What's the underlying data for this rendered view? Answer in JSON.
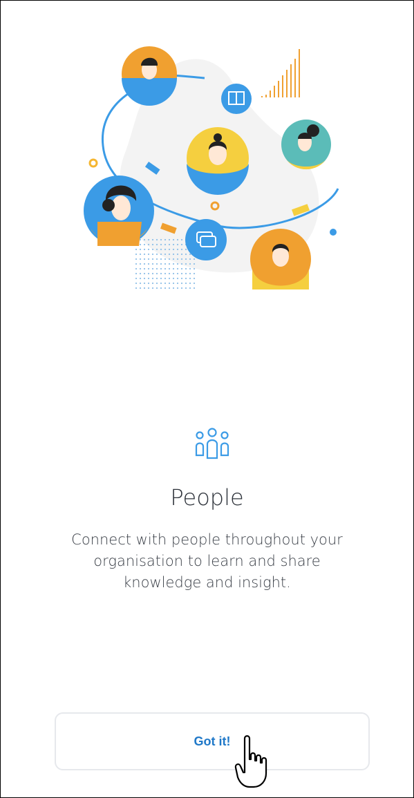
{
  "onboarding": {
    "illustration_name": "people-network-illustration",
    "feature_icon": "people-icon",
    "title": "People",
    "description": "Connect with people throughout your organisation to learn and share knowledge and insight.",
    "cta_label": "Got it!"
  },
  "colors": {
    "accent": "#1f78c8",
    "icon_blue": "#3b9be6",
    "orange": "#f0a030",
    "yellow": "#f5cf3f",
    "teal": "#5bbcb8",
    "blob": "#f3f3f3"
  },
  "cursor": "hand-pointer-icon"
}
